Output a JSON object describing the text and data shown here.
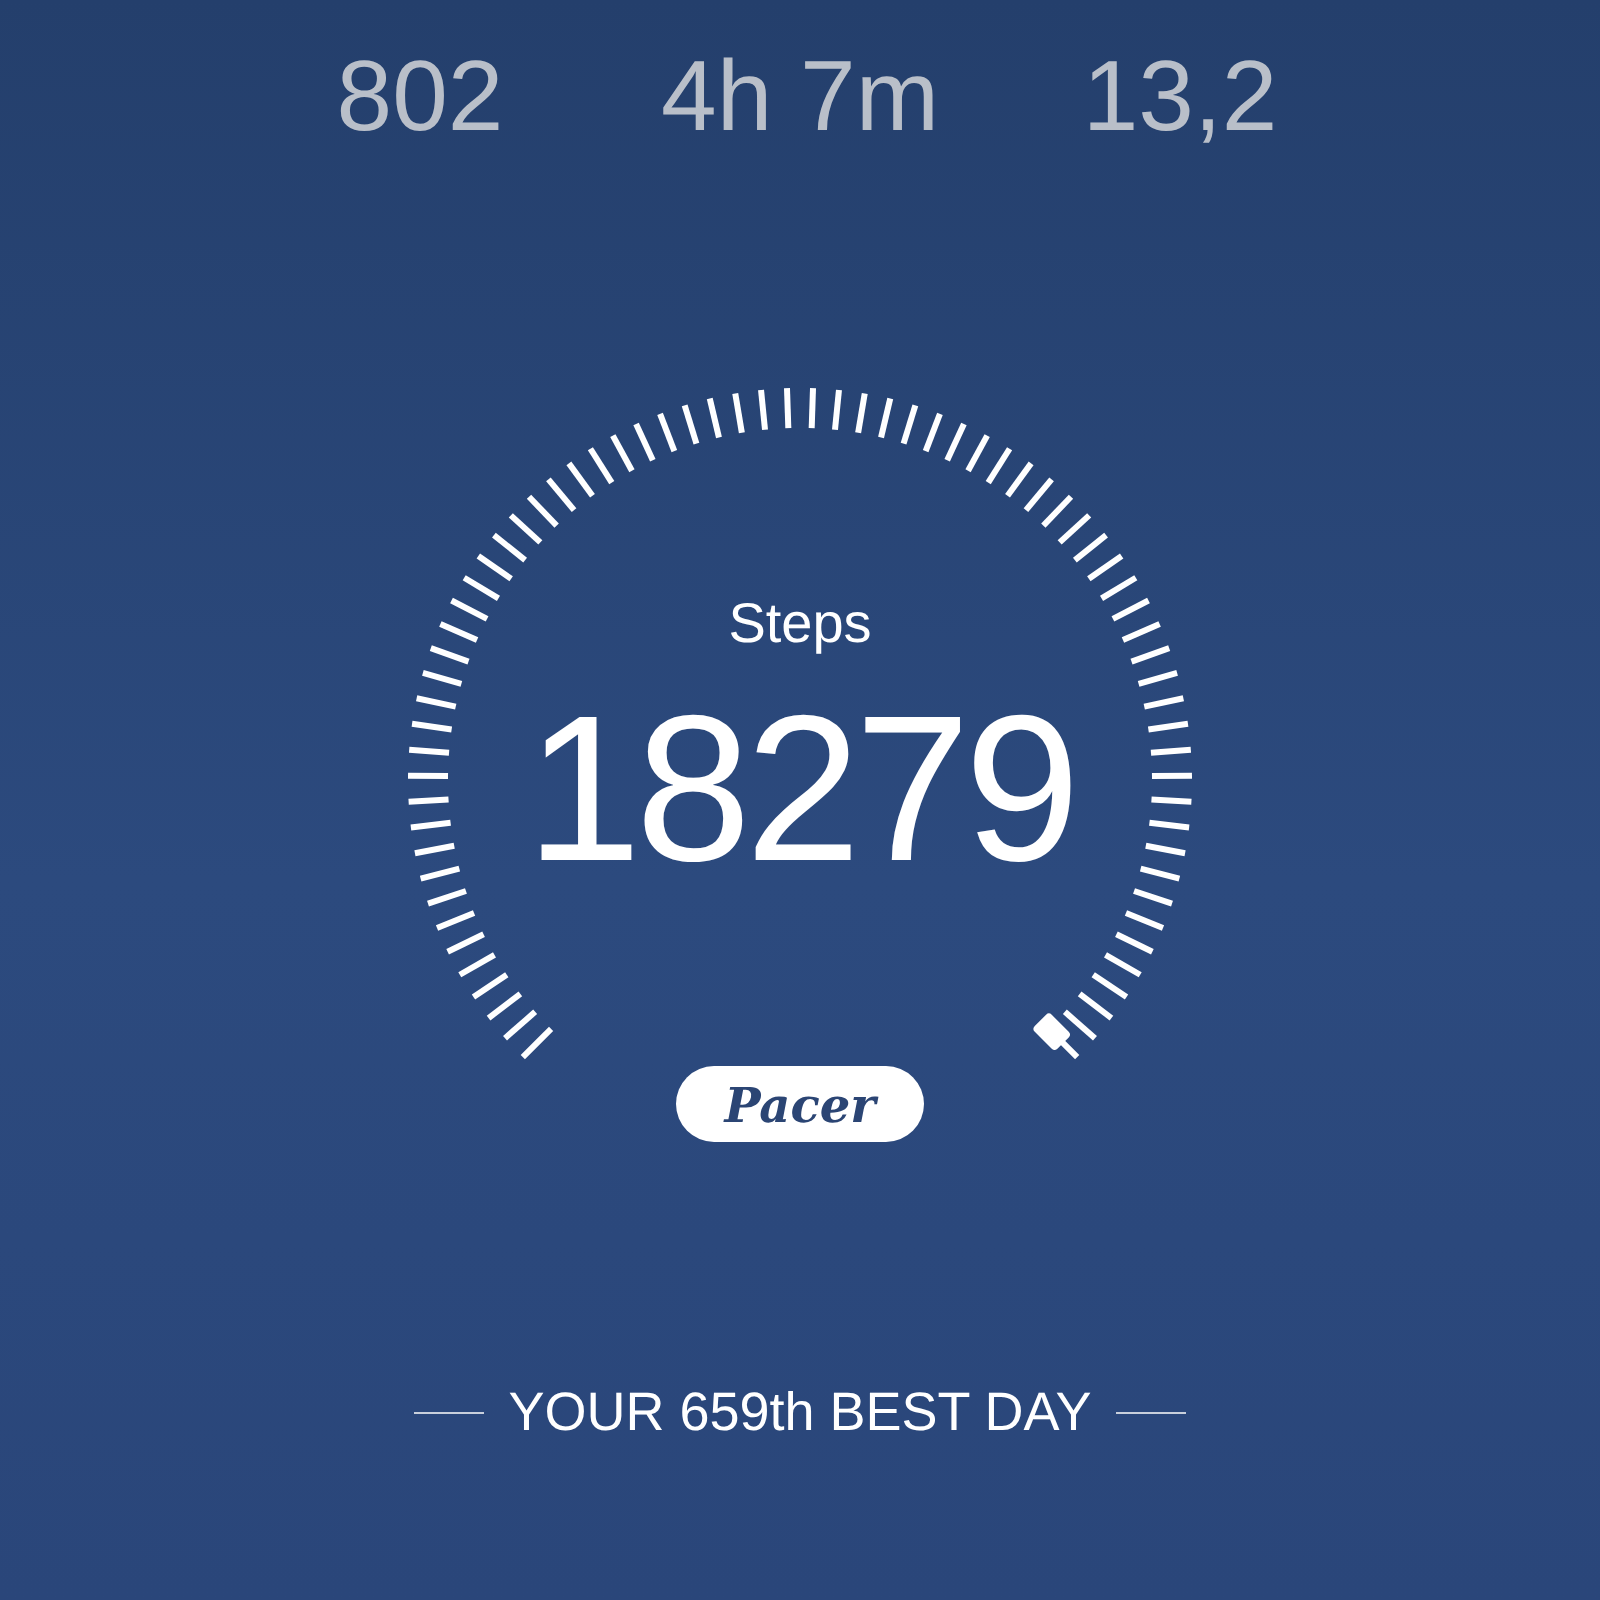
{
  "stats": [
    {
      "value": "802"
    },
    {
      "value": "4h 7m"
    },
    {
      "value": "13,2"
    }
  ],
  "gauge": {
    "label": "Steps",
    "value": "18279"
  },
  "brand": "Pacer",
  "rank": "YOUR 659th BEST DAY"
}
